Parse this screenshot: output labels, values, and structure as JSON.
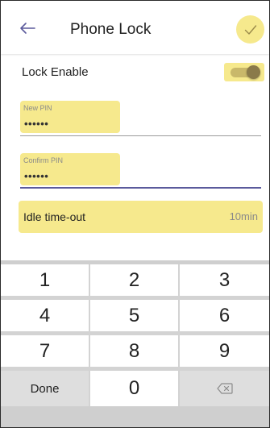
{
  "header": {
    "title": "Phone Lock",
    "back_icon": "arrow-left-icon",
    "confirm_icon": "checkmark-icon"
  },
  "lock_enable": {
    "label": "Lock Enable",
    "enabled": true
  },
  "new_pin": {
    "label": "New PIN",
    "value": "••••••"
  },
  "confirm_pin": {
    "label": "Confirm PIN",
    "value": "••••••"
  },
  "idle_timeout": {
    "label": "Idle time-out",
    "value": "10min"
  },
  "keypad": {
    "keys": [
      "1",
      "2",
      "3",
      "4",
      "5",
      "6",
      "7",
      "8",
      "9",
      "Done",
      "0"
    ],
    "backspace_icon": "backspace-icon"
  },
  "colors": {
    "highlight": "#f6e98d",
    "accent_underline": "#5b5a9c",
    "back_arrow": "#5b5a9c"
  }
}
